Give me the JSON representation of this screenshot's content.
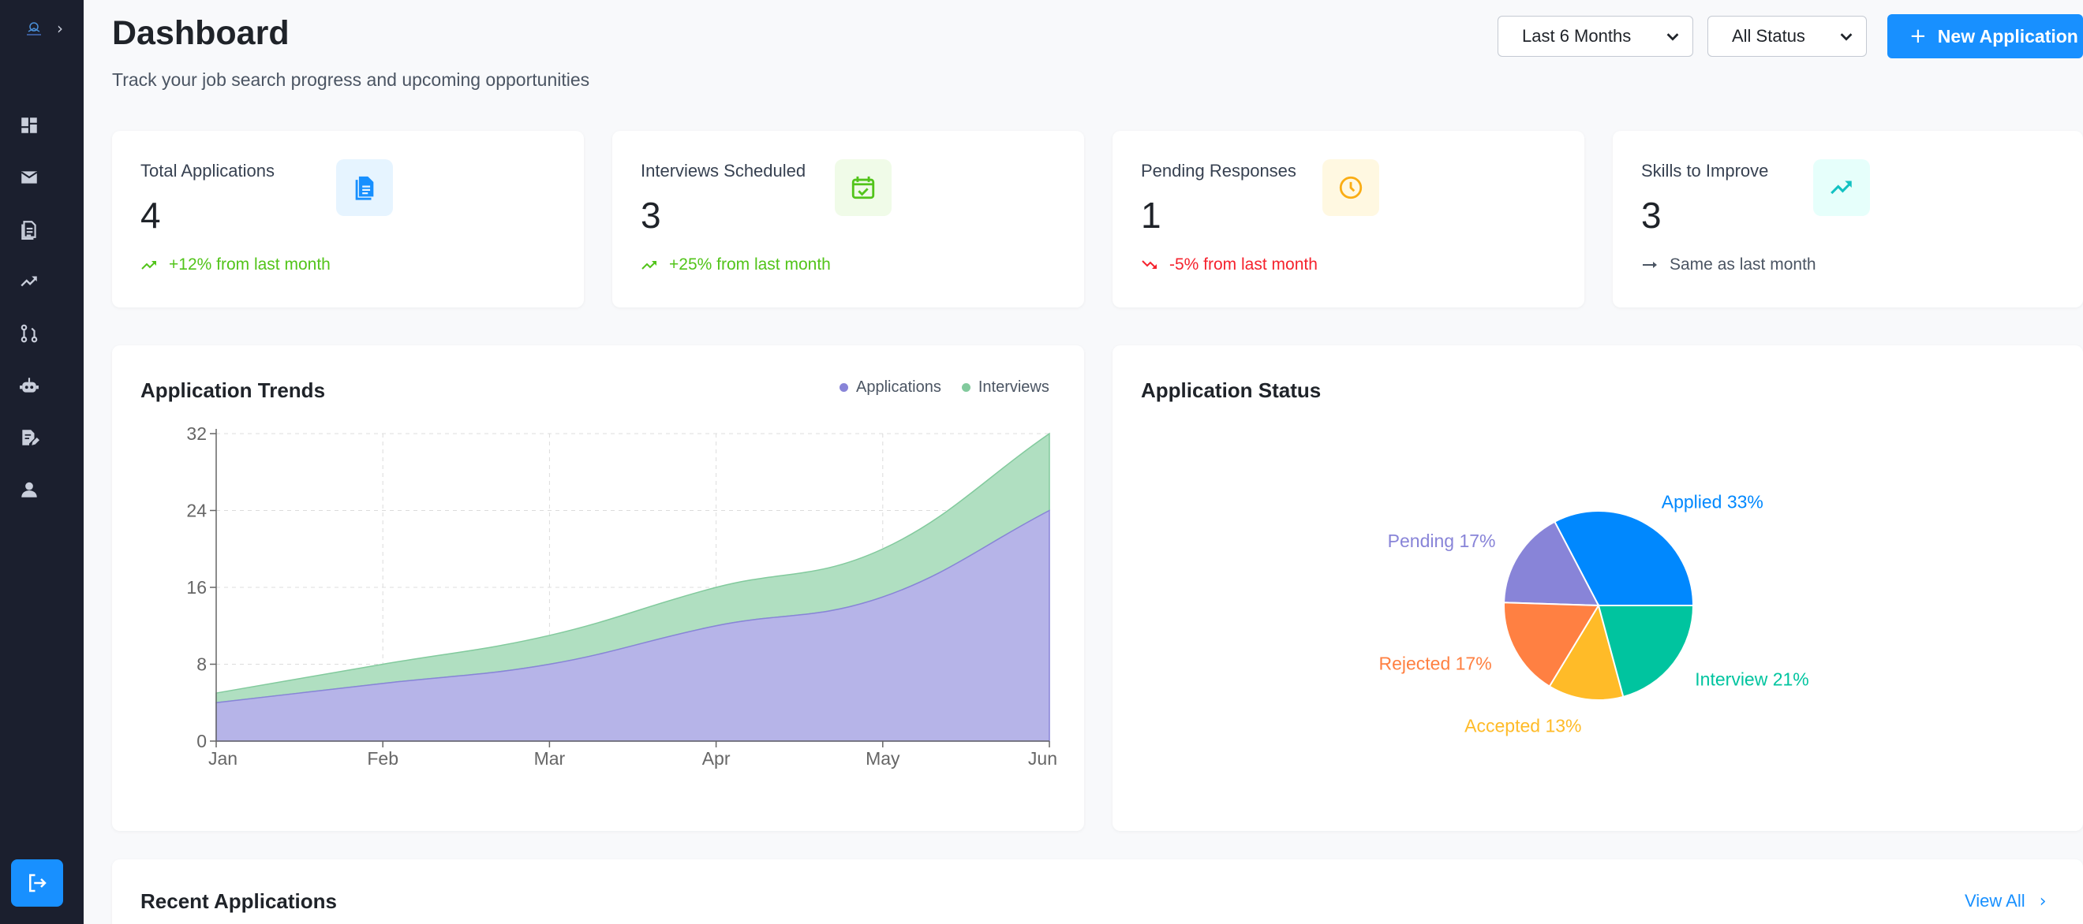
{
  "colors": {
    "sidebar_bg": "#1b1f2e",
    "accent": "#1890ff",
    "positive": "#52c41a",
    "negative": "#f5222d",
    "applications_area": "#b6b4e8",
    "interviews_area": "#b0dfc1"
  },
  "sidebar": {
    "expand_icon": "chevron-right-icon",
    "items": [
      {
        "icon": "dashboard-icon"
      },
      {
        "icon": "mail-icon"
      },
      {
        "icon": "document-icon"
      },
      {
        "icon": "trending-up-icon"
      },
      {
        "icon": "workflow-icon"
      },
      {
        "icon": "robot-icon"
      },
      {
        "icon": "edit-document-icon"
      },
      {
        "icon": "user-icon"
      }
    ],
    "logout_icon": "logout-icon"
  },
  "header": {
    "title": "Dashboard",
    "subtitle": "Track your job search progress and upcoming opportunities",
    "period_select": "Last 6 Months",
    "status_select": "All Status",
    "new_button": "New Application"
  },
  "stats": [
    {
      "label": "Total Applications",
      "value": "4",
      "trend": "+12% from last month",
      "trend_dir": "up",
      "icon": "document-icon",
      "icon_bg": "#e6f4ff",
      "icon_color": "#1890ff"
    },
    {
      "label": "Interviews Scheduled",
      "value": "3",
      "trend": "+25% from last month",
      "trend_dir": "up",
      "icon": "calendar-check-icon",
      "icon_bg": "#f0fbe8",
      "icon_color": "#52c41a"
    },
    {
      "label": "Pending Responses",
      "value": "1",
      "trend": "-5% from last month",
      "trend_dir": "down",
      "icon": "clock-icon",
      "icon_bg": "#fff8e1",
      "icon_color": "#faad14"
    },
    {
      "label": "Skills to Improve",
      "value": "3",
      "trend": "Same as last month",
      "trend_dir": "flat",
      "icon": "trending-up-icon",
      "icon_bg": "#e6fffb",
      "icon_color": "#13c2c2"
    }
  ],
  "trends_panel": {
    "title": "Application Trends"
  },
  "status_panel": {
    "title": "Application Status"
  },
  "recent": {
    "title": "Recent Applications",
    "view_all": "View All"
  },
  "chart_data": [
    {
      "type": "area",
      "stacked": true,
      "categories": [
        "Jan",
        "Feb",
        "Mar",
        "Apr",
        "May",
        "Jun"
      ],
      "series": [
        {
          "name": "Applications",
          "values": [
            4,
            6,
            8,
            12,
            15,
            24
          ],
          "color": "#8884d8"
        },
        {
          "name": "Interviews",
          "values": [
            1,
            2,
            3,
            4,
            5,
            8
          ],
          "color": "#82ca9d"
        }
      ],
      "yticks": [
        0,
        8,
        16,
        24,
        32
      ],
      "ylim": [
        0,
        32
      ],
      "grid": true,
      "legend": "top-right"
    },
    {
      "type": "pie",
      "slices": [
        {
          "label": "Applied",
          "value": 33,
          "text": "Applied 33%",
          "color": "#0088fe"
        },
        {
          "label": "Pending",
          "value": 17,
          "text": "Pending 17%",
          "color": "#8884d8"
        },
        {
          "label": "Rejected",
          "value": 17,
          "text": "Rejected 17%",
          "color": "#ff8042"
        },
        {
          "label": "Accepted",
          "value": 13,
          "text": "Accepted 13%",
          "color": "#ffbb28"
        },
        {
          "label": "Interview",
          "value": 21,
          "text": "Interview 21%",
          "color": "#00c49f"
        }
      ]
    }
  ]
}
